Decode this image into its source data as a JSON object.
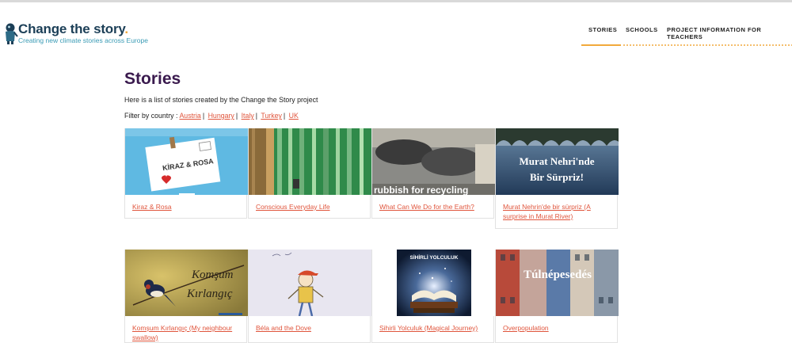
{
  "header": {
    "logo_title": "Change the story",
    "logo_dot": ".",
    "logo_subtitle": "Creating new climate stories across Europe",
    "nav": [
      {
        "label": "STORIES"
      },
      {
        "label": "SCHOOLS"
      },
      {
        "label": "PROJECT INFORMATION FOR TEACHERS"
      }
    ]
  },
  "main": {
    "title": "Stories",
    "intro": "Here is a list of stories created by the Change the Story project",
    "filter_label": "Filter by country :",
    "countries": [
      "Austria",
      "Hungary",
      "Italy",
      "Turkey",
      "UK"
    ]
  },
  "stories": [
    {
      "title": "Kiraz & Rosa",
      "image_text": "KİRAZ & ROSA"
    },
    {
      "title": "Conscious Everyday Life"
    },
    {
      "title": "What Can We Do for the Earth?",
      "image_text": "rubbish for recycling"
    },
    {
      "title": "Murat Nehrin'de bir sürpriz (A surprise in Murat River)",
      "image_text_1": "Murat Nehri'nde",
      "image_text_2": "Bir Sürpriz!"
    },
    {
      "title": "Komşum Kırlangıç (My neighbour swallow)",
      "image_text_1": "Komşum",
      "image_text_2": "Kırlangıç"
    },
    {
      "title": "Béla and the Dove"
    },
    {
      "title": "Sihirli Yolculuk (Magical Journey)",
      "image_text": "SİHİRLİ YOLCULUK"
    },
    {
      "title": "Overpopulation",
      "image_text": "Túlnépesedés"
    }
  ],
  "colors": {
    "accent": "#f2a93b",
    "link": "#e0553c",
    "title": "#3a1a4e",
    "brand": "#1c3f57"
  }
}
